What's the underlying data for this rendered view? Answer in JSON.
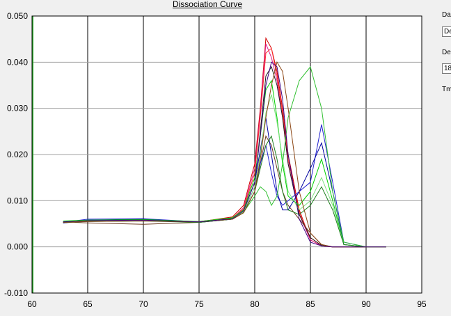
{
  "chart_title": "Dissociation Curve",
  "side_panel": {
    "label_1": "Da",
    "field_1": "De",
    "label_2": "De",
    "field_2": "18",
    "label_3": "Tm"
  },
  "chart_data": {
    "type": "line",
    "title": "Dissociation Curve",
    "xlim": [
      60,
      95
    ],
    "ylim": [
      -0.01,
      0.05
    ],
    "x_ticks": [
      "60",
      "65",
      "70",
      "75",
      "80",
      "85",
      "90",
      "95"
    ],
    "y_ticks": [
      "0.050",
      "0.040",
      "0.030",
      "0.020",
      "0.010",
      "0.000",
      "-0.010"
    ],
    "vertical_grid": [
      65,
      70,
      75,
      80,
      85,
      90
    ],
    "horizontal_grid": [
      0.04,
      0.03,
      0.02,
      0.01,
      0.0
    ],
    "series": [
      {
        "color": "#d00000",
        "x": [
          62.8,
          65,
          70,
          75,
          78,
          79,
          80,
          80.5,
          81,
          81.5,
          82,
          82.5,
          83,
          84,
          85,
          86,
          87,
          88,
          90,
          91.8
        ],
        "y": [
          0.0053,
          0.0057,
          0.0058,
          0.0054,
          0.0065,
          0.009,
          0.018,
          0.03,
          0.0452,
          0.043,
          0.038,
          0.03,
          0.02,
          0.008,
          0.0015,
          0.0002,
          0,
          0,
          0,
          0
        ]
      },
      {
        "color": "#e0208a",
        "x": [
          62.8,
          65,
          70,
          75,
          78,
          79,
          80,
          80.5,
          81,
          81.5,
          82,
          82.5,
          83,
          84,
          85,
          86,
          87,
          88,
          90,
          91.8
        ],
        "y": [
          0.0054,
          0.0055,
          0.0057,
          0.0053,
          0.0062,
          0.0085,
          0.017,
          0.029,
          0.044,
          0.041,
          0.036,
          0.028,
          0.018,
          0.007,
          0.0015,
          0.0002,
          0,
          0,
          0,
          0
        ]
      },
      {
        "color": "#ff3030",
        "x": [
          62.8,
          65,
          70,
          75,
          78,
          79,
          80,
          80.5,
          81,
          81.5,
          82,
          82.5,
          83,
          84,
          85,
          86,
          87,
          88,
          90,
          91.8
        ],
        "y": [
          0.0055,
          0.0056,
          0.0058,
          0.0055,
          0.0063,
          0.0082,
          0.016,
          0.028,
          0.042,
          0.043,
          0.037,
          0.029,
          0.019,
          0.0075,
          0.002,
          0.0003,
          0,
          0,
          0,
          0
        ]
      },
      {
        "color": "#202020",
        "x": [
          62.8,
          65,
          70,
          75,
          78,
          79,
          80,
          80.5,
          81,
          81.5,
          82,
          82.5,
          83,
          84,
          85,
          86,
          87,
          88,
          90,
          91.8
        ],
        "y": [
          0.0052,
          0.0056,
          0.0057,
          0.0054,
          0.006,
          0.0078,
          0.014,
          0.025,
          0.037,
          0.039,
          0.035,
          0.028,
          0.018,
          0.007,
          0.002,
          0.0003,
          0,
          0,
          0,
          0
        ]
      },
      {
        "color": "#6b3a1f",
        "x": [
          62.8,
          65,
          70,
          75,
          78,
          79,
          80,
          80.5,
          81,
          81.5,
          82,
          82.5,
          83,
          84,
          85,
          86,
          87,
          88,
          90,
          91.8
        ],
        "y": [
          0.0054,
          0.0052,
          0.0049,
          0.0053,
          0.006,
          0.0075,
          0.012,
          0.018,
          0.024,
          0.022,
          0.017,
          0.012,
          0.009,
          0.006,
          0.003,
          0.0005,
          0,
          0,
          0,
          0
        ]
      },
      {
        "color": "#2020d0",
        "x": [
          62.8,
          65,
          70,
          75,
          78,
          79,
          80,
          80.5,
          81,
          81.5,
          82,
          82.5,
          83,
          84,
          85,
          86,
          87,
          88,
          90,
          91.8
        ],
        "y": [
          0.0053,
          0.006,
          0.0061,
          0.0054,
          0.006,
          0.0075,
          0.013,
          0.018,
          0.022,
          0.016,
          0.011,
          0.009,
          0.01,
          0.012,
          0.014,
          0.0265,
          0.014,
          0.001,
          0,
          0
        ]
      },
      {
        "color": "#0000a0",
        "x": [
          62.8,
          65,
          70,
          75,
          78,
          79,
          80,
          80.5,
          81,
          81.5,
          82,
          82.5,
          83,
          84,
          85,
          86,
          87,
          88,
          90,
          91.8
        ],
        "y": [
          0.0052,
          0.0058,
          0.006,
          0.0053,
          0.006,
          0.0078,
          0.014,
          0.021,
          0.028,
          0.02,
          0.012,
          0.008,
          0.008,
          0.012,
          0.017,
          0.0225,
          0.012,
          0.0005,
          0,
          0
        ]
      },
      {
        "color": "#30c030",
        "x": [
          62.8,
          65,
          70,
          75,
          78,
          79,
          80,
          80.5,
          81,
          81.5,
          82,
          82.5,
          83,
          84,
          85,
          86,
          87,
          88,
          90,
          91.8
        ],
        "y": [
          0.0055,
          0.0057,
          0.0058,
          0.0054,
          0.0062,
          0.0075,
          0.011,
          0.013,
          0.012,
          0.009,
          0.011,
          0.018,
          0.028,
          0.036,
          0.039,
          0.03,
          0.012,
          0.001,
          0,
          0
        ]
      },
      {
        "color": "#00d000",
        "x": [
          62.8,
          65,
          70,
          75,
          78,
          79,
          80,
          80.5,
          81,
          81.5,
          82,
          82.5,
          83,
          84,
          85,
          86,
          87,
          88,
          90,
          91.8
        ],
        "y": [
          0.0056,
          0.0058,
          0.0059,
          0.0055,
          0.0063,
          0.008,
          0.015,
          0.024,
          0.034,
          0.036,
          0.028,
          0.018,
          0.011,
          0.009,
          0.012,
          0.019,
          0.01,
          0.0005,
          0,
          0
        ]
      },
      {
        "color": "#80e080",
        "x": [
          62.8,
          65,
          70,
          75,
          78,
          79,
          80,
          80.5,
          81,
          81.5,
          82,
          82.5,
          83,
          84,
          85,
          86,
          87,
          88,
          90,
          91.8
        ],
        "y": [
          0.0054,
          0.0056,
          0.0057,
          0.0054,
          0.0061,
          0.0076,
          0.013,
          0.02,
          0.029,
          0.033,
          0.027,
          0.019,
          0.012,
          0.008,
          0.01,
          0.015,
          0.009,
          0.0005,
          0,
          0
        ]
      },
      {
        "color": "#208020",
        "x": [
          62.8,
          65,
          70,
          75,
          78,
          79,
          80,
          80.5,
          81,
          81.5,
          82,
          82.5,
          83,
          84,
          85,
          86,
          87,
          88,
          90,
          91.8
        ],
        "y": [
          0.0053,
          0.0055,
          0.0056,
          0.0053,
          0.006,
          0.0074,
          0.012,
          0.017,
          0.022,
          0.024,
          0.019,
          0.012,
          0.008,
          0.007,
          0.009,
          0.013,
          0.008,
          0.0005,
          0,
          0
        ]
      },
      {
        "color": "#8b4513",
        "x": [
          62.8,
          65,
          70,
          75,
          78,
          79,
          80,
          80.5,
          81,
          81.5,
          82,
          82.5,
          83,
          84,
          85,
          86,
          87,
          88,
          90,
          91.8
        ],
        "y": [
          0.0053,
          0.0055,
          0.0056,
          0.0054,
          0.006,
          0.0074,
          0.012,
          0.019,
          0.028,
          0.035,
          0.04,
          0.038,
          0.03,
          0.012,
          0.003,
          0.0005,
          0,
          0,
          0,
          0
        ]
      },
      {
        "color": "#400080",
        "x": [
          62.8,
          65,
          70,
          75,
          78,
          79,
          80,
          80.5,
          81,
          81.5,
          82,
          82.5,
          83,
          84,
          85,
          86,
          87,
          88,
          90,
          91.8
        ],
        "y": [
          0.0054,
          0.0057,
          0.0058,
          0.0054,
          0.0061,
          0.0078,
          0.014,
          0.024,
          0.035,
          0.04,
          0.039,
          0.032,
          0.02,
          0.006,
          0.001,
          0.0002,
          0,
          0,
          0,
          0
        ]
      }
    ]
  }
}
